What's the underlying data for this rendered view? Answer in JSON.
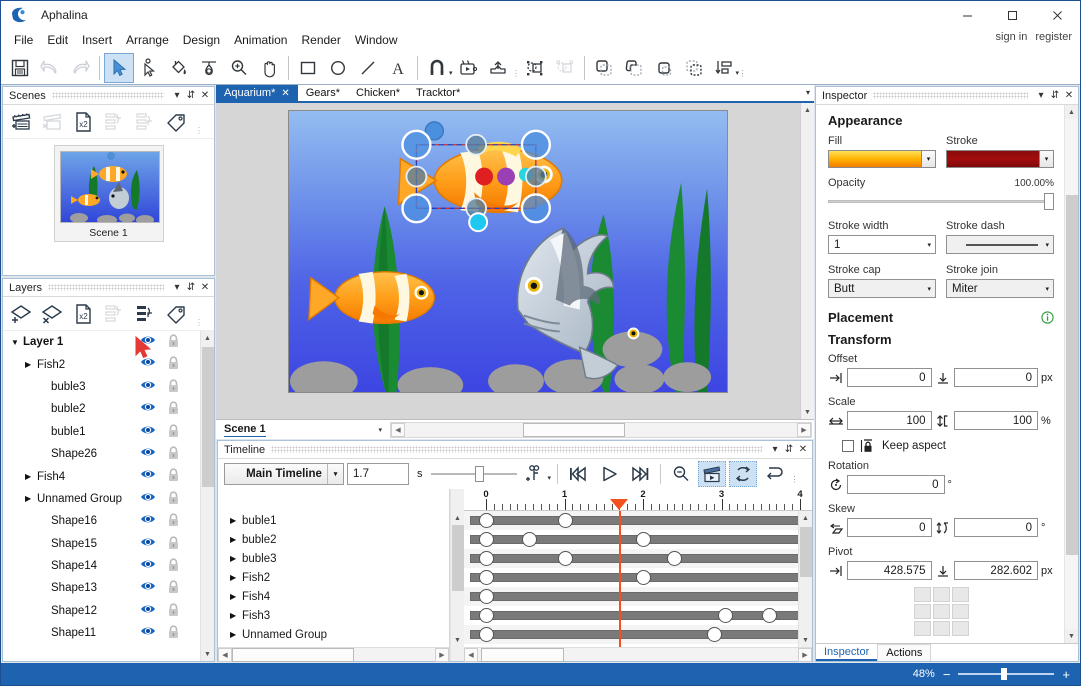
{
  "app": {
    "name": "Aphalina",
    "logo_icon": "app-logo-icon"
  },
  "window_controls": {
    "minimize": "–",
    "maximize": "□",
    "close": "✕"
  },
  "account": {
    "sign_in": "sign in",
    "register": "register"
  },
  "menu": {
    "items": [
      "File",
      "Edit",
      "Insert",
      "Arrange",
      "Design",
      "Animation",
      "Render",
      "Window"
    ]
  },
  "toolbar": {
    "groups": [
      {
        "items": [
          {
            "name": "save-icon",
            "label": "Save",
            "state": "normal"
          },
          {
            "name": "undo-icon",
            "label": "Undo",
            "state": "disabled"
          },
          {
            "name": "redo-icon",
            "label": "Redo",
            "state": "disabled"
          }
        ]
      },
      {
        "items": [
          {
            "name": "select-tool-icon",
            "label": "Select",
            "state": "active"
          },
          {
            "name": "node-edit-tool-icon",
            "label": "Node edit",
            "state": "normal"
          },
          {
            "name": "fill-tool-icon",
            "label": "Fill",
            "state": "normal"
          },
          {
            "name": "gradient-tool-icon",
            "label": "Gradient",
            "state": "normal"
          },
          {
            "name": "zoom-tool-icon",
            "label": "Zoom",
            "state": "normal"
          },
          {
            "name": "pan-tool-icon",
            "label": "Pan",
            "state": "normal"
          }
        ]
      },
      {
        "items": [
          {
            "name": "rectangle-tool-icon",
            "label": "Rectangle",
            "state": "normal"
          },
          {
            "name": "ellipse-tool-icon",
            "label": "Ellipse",
            "state": "normal"
          },
          {
            "name": "line-tool-icon",
            "label": "Line",
            "state": "normal"
          },
          {
            "name": "text-tool-icon",
            "label": "Text",
            "state": "normal"
          }
        ]
      },
      {
        "items": [
          {
            "name": "snap-magnet-icon",
            "label": "Snap",
            "state": "caret"
          },
          {
            "name": "preview-animation-icon",
            "label": "Preview",
            "state": "normal"
          },
          {
            "name": "export-icon",
            "label": "Export",
            "state": "normal"
          }
        ]
      },
      {
        "items": [
          {
            "name": "group-icon",
            "label": "Group",
            "state": "normal"
          },
          {
            "name": "ungroup-icon",
            "label": "Ungroup",
            "state": "disabled"
          }
        ]
      },
      {
        "items": [
          {
            "name": "union-icon",
            "label": "Union",
            "state": "normal"
          },
          {
            "name": "subtract-icon",
            "label": "Subtract",
            "state": "normal"
          },
          {
            "name": "intersect-icon",
            "label": "Intersect",
            "state": "normal"
          },
          {
            "name": "exclude-icon",
            "label": "Exclude",
            "state": "normal"
          },
          {
            "name": "align-distribute-icon",
            "label": "Align",
            "state": "caret"
          }
        ]
      }
    ]
  },
  "scenes_panel": {
    "title": "Scenes",
    "header_buttons": [
      {
        "name": "panel-collapse-icon",
        "glyph": "▾"
      },
      {
        "name": "panel-pin-icon",
        "glyph": "⇵"
      },
      {
        "name": "panel-close-icon",
        "glyph": "✕"
      }
    ],
    "tools": [
      {
        "name": "add-scene-icon",
        "label": "Add scene",
        "state": "normal"
      },
      {
        "name": "delete-scene-icon",
        "label": "Delete scene",
        "state": "disabled"
      },
      {
        "name": "duplicate-scene-icon",
        "label": "Duplicate scene",
        "state": "normal"
      },
      {
        "name": "move-scene-up-icon",
        "label": "Move up",
        "state": "disabled"
      },
      {
        "name": "move-scene-down-icon",
        "label": "Move down",
        "state": "disabled"
      },
      {
        "name": "scene-tag-icon",
        "label": "Tag",
        "state": "normal"
      }
    ],
    "scenes": [
      {
        "label": "Scene 1",
        "selected": true
      }
    ]
  },
  "layers_panel": {
    "title": "Layers",
    "tools": [
      {
        "name": "add-layer-icon",
        "label": "Add layer",
        "state": "normal"
      },
      {
        "name": "delete-layer-icon",
        "label": "Delete layer",
        "state": "normal"
      },
      {
        "name": "duplicate-layer-icon",
        "label": "Duplicate layer",
        "state": "normal"
      },
      {
        "name": "move-layer-up-icon",
        "label": "Move up",
        "state": "disabled"
      },
      {
        "name": "move-layer-down-icon",
        "label": "Move down",
        "state": "normal"
      },
      {
        "name": "layer-tag-icon",
        "label": "Tag",
        "state": "normal"
      }
    ],
    "column_icons": {
      "visibility": "eye-icon",
      "lock": "lock-icon"
    },
    "items": [
      {
        "label": "Layer 1",
        "indent": 0,
        "expander": "down",
        "bold": true,
        "visible": true,
        "locked": false
      },
      {
        "label": "Fish2",
        "indent": 1,
        "expander": "right",
        "visible": true,
        "locked": false
      },
      {
        "label": "buble3",
        "indent": 2,
        "expander": "none",
        "visible": true,
        "locked": false
      },
      {
        "label": "buble2",
        "indent": 2,
        "expander": "none",
        "visible": true,
        "locked": false
      },
      {
        "label": "buble1",
        "indent": 2,
        "expander": "none",
        "visible": true,
        "locked": false
      },
      {
        "label": "Shape26",
        "indent": 2,
        "expander": "none",
        "visible": true,
        "locked": false
      },
      {
        "label": "Fish4",
        "indent": 1,
        "expander": "right",
        "visible": true,
        "locked": false
      },
      {
        "label": "Unnamed Group",
        "indent": 1,
        "expander": "right",
        "visible": true,
        "locked": false
      },
      {
        "label": "Shape16",
        "indent": 2,
        "expander": "none",
        "visible": true,
        "locked": false
      },
      {
        "label": "Shape15",
        "indent": 2,
        "expander": "none",
        "visible": true,
        "locked": false
      },
      {
        "label": "Shape14",
        "indent": 2,
        "expander": "none",
        "visible": true,
        "locked": false
      },
      {
        "label": "Shape13",
        "indent": 2,
        "expander": "none",
        "visible": true,
        "locked": false
      },
      {
        "label": "Shape12",
        "indent": 2,
        "expander": "none",
        "visible": true,
        "locked": false
      },
      {
        "label": "Shape11",
        "indent": 2,
        "expander": "none",
        "visible": true,
        "locked": false
      }
    ],
    "cursor": "arrow-cursor-red"
  },
  "document_tabs": {
    "tabs": [
      {
        "label": "Aquarium*",
        "active": true,
        "closable": true
      },
      {
        "label": "Gears*",
        "active": false,
        "closable": false
      },
      {
        "label": "Chicken*",
        "active": false,
        "closable": false
      },
      {
        "label": "Tracktor*",
        "active": false,
        "closable": false
      }
    ],
    "overflow_icon": "chevron-down-icon"
  },
  "canvas": {
    "scene_selector": "Scene 1",
    "artwork_name": "aquarium-illustration",
    "selection": {
      "handles": 8,
      "style": "dashed-red-blue"
    }
  },
  "timeline_panel": {
    "title": "Timeline",
    "header_buttons": [
      {
        "name": "panel-collapse-icon",
        "glyph": "▾"
      },
      {
        "name": "panel-pin-icon",
        "glyph": "⇵"
      },
      {
        "name": "panel-close-icon",
        "glyph": "✕"
      }
    ],
    "timeline_select": "Main Timeline",
    "current_time": "1.7",
    "time_unit": "s",
    "buttons": [
      {
        "name": "add-keyframe-icon",
        "label": "Add keyframe",
        "state": "caret"
      },
      {
        "name": "go-to-start-icon",
        "label": "Go to start",
        "state": "normal"
      },
      {
        "name": "play-icon",
        "label": "Play",
        "state": "normal"
      },
      {
        "name": "go-to-end-icon",
        "label": "Go to end",
        "state": "normal"
      },
      {
        "name": "zoom-out-timeline-icon",
        "label": "Zoom out",
        "state": "normal"
      },
      {
        "name": "preview-clapper-icon",
        "label": "Preview",
        "state": "active"
      },
      {
        "name": "loop-icon",
        "label": "Loop",
        "state": "active"
      },
      {
        "name": "reverse-icon",
        "label": "Reverse",
        "state": "normal"
      }
    ],
    "ruler_ticks": [
      "0",
      "1",
      "2",
      "3",
      "4"
    ],
    "playhead_time": 1.7,
    "rows": [
      {
        "label": "buble1",
        "keys": [
          0,
          1
        ]
      },
      {
        "label": "buble2",
        "keys": [
          0,
          0.55,
          2
        ]
      },
      {
        "label": "buble3",
        "keys": [
          0,
          1,
          2.4
        ]
      },
      {
        "label": "Fish2",
        "keys": [
          0,
          2
        ]
      },
      {
        "label": "Fish4",
        "keys": [
          0
        ]
      },
      {
        "label": "Fish3",
        "keys": [
          0,
          3.05,
          3.6
        ]
      },
      {
        "label": "Unnamed Group",
        "keys": [
          0,
          2.9
        ]
      }
    ]
  },
  "inspector": {
    "title": "Inspector",
    "header_buttons": [
      {
        "name": "panel-collapse-icon",
        "glyph": "▾"
      },
      {
        "name": "panel-pin-icon",
        "glyph": "⇵"
      },
      {
        "name": "panel-close-icon",
        "glyph": "✕"
      }
    ],
    "appearance": {
      "section_title": "Appearance",
      "fill_label": "Fill",
      "fill_color": "#ffb300",
      "fill_gradient_from": "#ffe15a",
      "fill_gradient_to": "#f57c00",
      "stroke_label": "Stroke",
      "stroke_color": "#a30d0d",
      "opacity_label": "Opacity",
      "opacity_value": "100.00%",
      "stroke_width_label": "Stroke width",
      "stroke_width_value": "1",
      "stroke_dash_label": "Stroke dash",
      "stroke_dash_value": "solid-line",
      "stroke_cap_label": "Stroke cap",
      "stroke_cap_value": "Butt",
      "stroke_join_label": "Stroke join",
      "stroke_join_value": "Miter"
    },
    "placement": {
      "section_title": "Placement",
      "info_icon": "info-icon",
      "transform_title": "Transform",
      "offset_label": "Offset",
      "offset_x": "0",
      "offset_y": "0",
      "offset_unit": "px",
      "scale_label": "Scale",
      "scale_x": "100",
      "scale_y": "100",
      "scale_unit": "%",
      "keep_aspect_label": "Keep aspect",
      "keep_aspect_checked": false,
      "rotation_label": "Rotation",
      "rotation_value": "0",
      "rotation_unit": "°",
      "skew_label": "Skew",
      "skew_x": "0",
      "skew_y": "0",
      "skew_unit": "°",
      "pivot_label": "Pivot",
      "pivot_x": "428.575",
      "pivot_y": "282.602",
      "pivot_unit": "px"
    },
    "tabs": [
      {
        "label": "Inspector",
        "active": true
      },
      {
        "label": "Actions",
        "active": false
      }
    ]
  },
  "statusbar": {
    "zoom_value": "48%",
    "zoom_minus": "−",
    "zoom_plus": "+",
    "accent_color": "#1e63b0"
  }
}
